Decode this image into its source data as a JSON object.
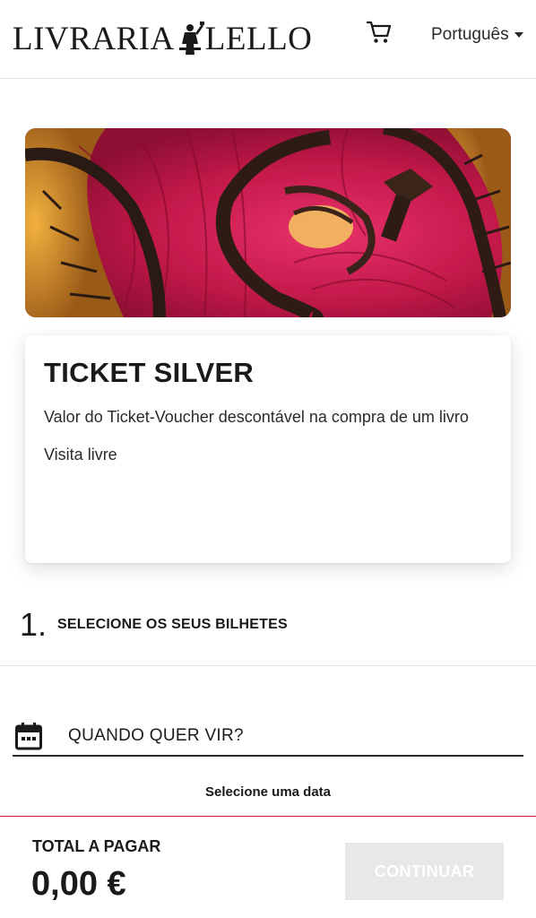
{
  "header": {
    "logo_left": "LIVRARIA",
    "logo_right": "LELLO",
    "language": "Português"
  },
  "hero": {
    "alt": "Escadaria vermelha da Livraria Lello"
  },
  "ticket": {
    "title": "TICKET SILVER",
    "description": "Valor do Ticket-Voucher descontável na compra de um livro",
    "note": "Visita livre"
  },
  "step": {
    "number": "1.",
    "label": "SELECIONE OS SEUS BILHETES"
  },
  "date": {
    "label": "QUANDO QUER VIR?",
    "hint": "Selecione uma data"
  },
  "footer": {
    "total_label": "TOTAL A PAGAR",
    "total_value": "0,00 €",
    "continue_label": "CONTINUAR"
  },
  "colors": {
    "accent_red": "#d4243a",
    "stair_red": "#c2184a",
    "disabled_button": "#e8e8e8"
  }
}
